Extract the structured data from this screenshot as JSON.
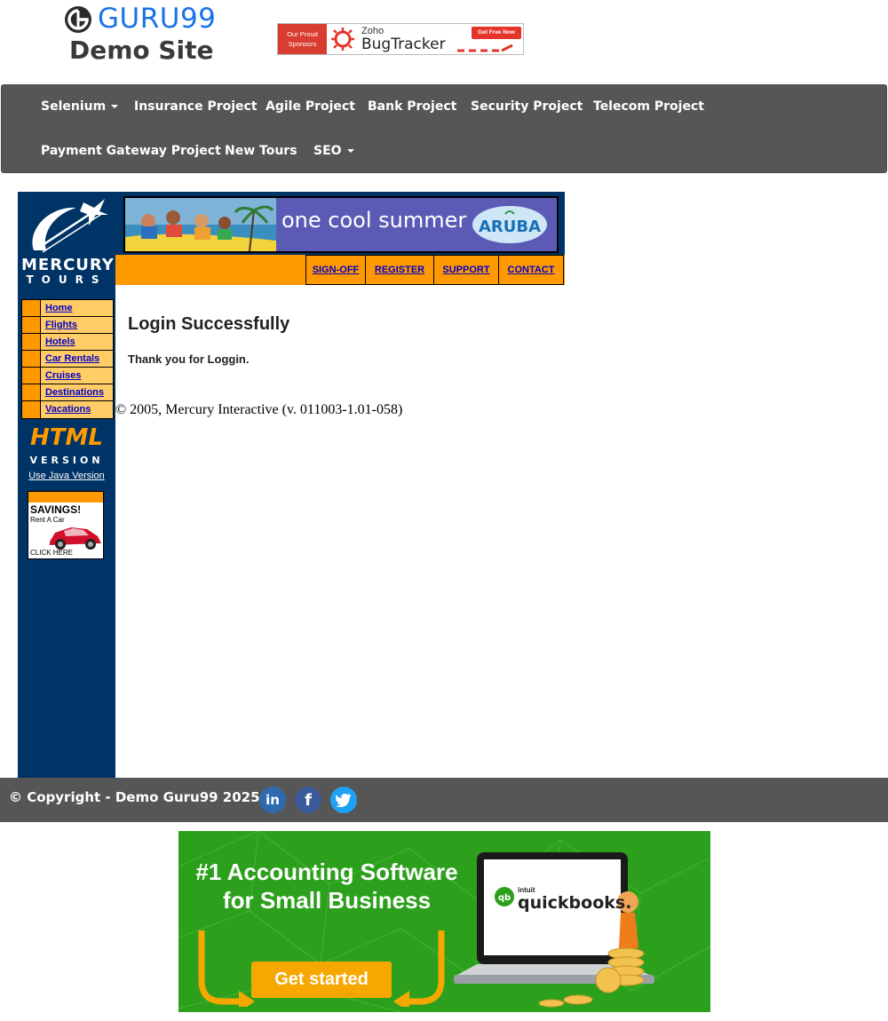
{
  "header": {
    "logo_brand": "GURU99",
    "logo_subtitle": "Demo Site",
    "sponsor": {
      "tag_line1": "Our Proud",
      "tag_line2": "Sponsors",
      "brand_small": "Zoho",
      "brand_name": "BugTracker",
      "cta": "Get Free Now"
    }
  },
  "nav": {
    "row1": [
      {
        "label": "Selenium",
        "dropdown": true
      },
      {
        "label": "Insurance Project",
        "dropdown": false
      },
      {
        "label": "Agile Project",
        "dropdown": false
      },
      {
        "label": "Bank Project",
        "dropdown": false
      },
      {
        "label": "Security Project",
        "dropdown": false
      },
      {
        "label": "Telecom Project",
        "dropdown": false
      }
    ],
    "row2": [
      {
        "label": "Payment Gateway Project",
        "dropdown": false
      },
      {
        "label": "New Tours",
        "dropdown": false
      },
      {
        "label": "SEO",
        "dropdown": true
      }
    ]
  },
  "mercury": {
    "logo_line1": "MERCURY",
    "logo_line2": "TOURS",
    "side_menu": [
      "Home",
      "Flights",
      "Hotels",
      "Car Rentals",
      "Cruises",
      "Destinations",
      "Vacations"
    ],
    "html_version_line1": "HTML",
    "html_version_line2": "VERSION",
    "java_link": "Use Java Version",
    "savings_ad": {
      "title": "SAVINGS!",
      "subtitle": "Rent A Car",
      "cta": "CLICK HERE"
    },
    "promo": {
      "text": "one cool summer",
      "brand": "ARUBA"
    },
    "top_links": [
      "SIGN-OFF",
      "REGISTER",
      "SUPPORT",
      "CONTACT"
    ],
    "content": {
      "title": "Login Successfully",
      "message": "Thank you for Loggin.",
      "copyright": "© 2005, Mercury Interactive (v. 011003-1.01-058)"
    }
  },
  "footer": {
    "copyright": "© Copyright - Demo Guru99 2025",
    "social": [
      {
        "name": "linkedin",
        "glyph": "in",
        "color": "#2f6ab0"
      },
      {
        "name": "facebook",
        "glyph": "f",
        "color": "#3b5a9a"
      },
      {
        "name": "twitter",
        "glyph": "t",
        "color": "#1da1f2"
      }
    ]
  },
  "ad": {
    "headline_line1": "#1 Accounting Software",
    "headline_line2": "for Small Business",
    "cta": "Get started",
    "brand_small": "intuit",
    "brand_name": "quickbooks."
  },
  "colors": {
    "nav_bg": "#565656",
    "mercury_blue": "#003366",
    "mercury_orange": "#ff9900",
    "guru_blue": "#1a73e8",
    "qb_green": "#2ca01c"
  }
}
